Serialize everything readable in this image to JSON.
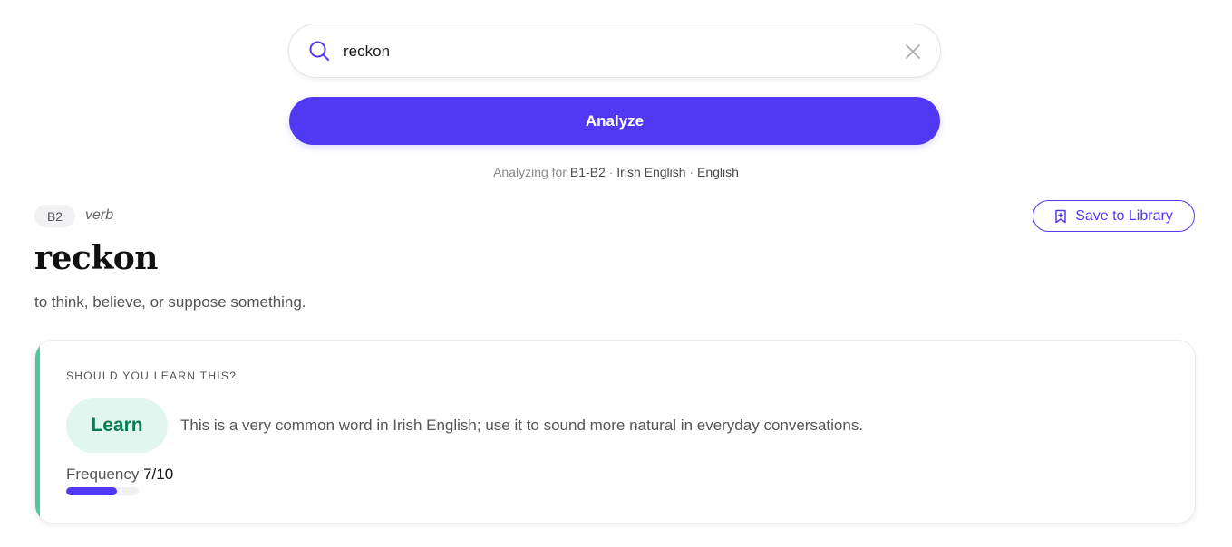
{
  "search": {
    "value": "reckon",
    "clear_icon": "close-icon",
    "search_icon": "search-icon"
  },
  "analyze_label": "Analyze",
  "context": {
    "prefix": "Analyzing for",
    "level": "B1-B2",
    "sep1": " · ",
    "variety": "Irish English",
    "sep2": " · ",
    "language": "English"
  },
  "entry": {
    "level": "B2",
    "part_of_speech": "verb",
    "word": "reckon",
    "definition": "to think, believe, or suppose something.",
    "save_label": "Save to Library",
    "save_icon": "bookmark-icon"
  },
  "recommendation_card": {
    "heading": "SHOULD YOU LEARN THIS?",
    "verdict": "Learn",
    "explanation": "This is a very common word in Irish English; use it to sound more natural in everyday conversations.",
    "frequency_label": "Frequency",
    "frequency_value": "7/10",
    "frequency_fraction": 0.7
  },
  "colors": {
    "accent": "#5138f5",
    "learn_green": "#0d7a52",
    "learn_bg": "#e1f6ee",
    "card_accent": "#4bcaa0"
  }
}
